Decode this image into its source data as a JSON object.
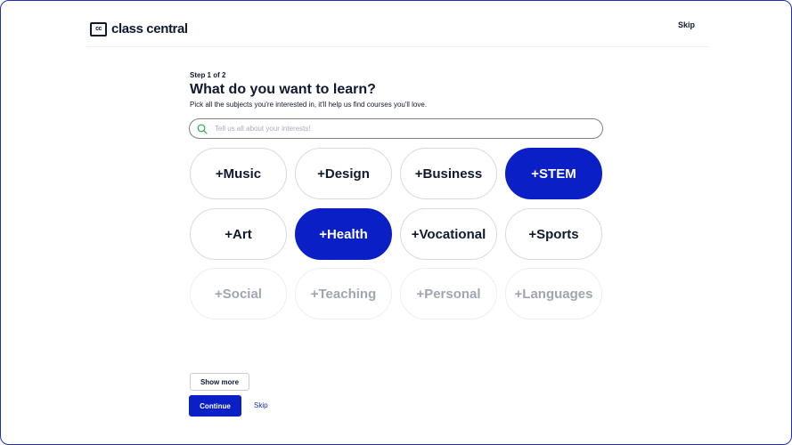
{
  "header": {
    "logo_mark": "cc",
    "logo_text": "class central",
    "skip_label": "Skip"
  },
  "step_label": "Step 1 of 2",
  "title": "What do you want to learn?",
  "subtitle": "Pick all the subjects you're interested in, it'll help us find courses you'll love.",
  "search": {
    "placeholder": "Tell us all about your interests!",
    "value": ""
  },
  "subjects": [
    {
      "label": "+Music",
      "state": "default"
    },
    {
      "label": "+Design",
      "state": "default"
    },
    {
      "label": "+Business",
      "state": "default"
    },
    {
      "label": "+STEM",
      "state": "selected"
    },
    {
      "label": "+Art",
      "state": "default"
    },
    {
      "label": "+Health",
      "state": "selected"
    },
    {
      "label": "+Vocational",
      "state": "default"
    },
    {
      "label": "+Sports",
      "state": "default"
    },
    {
      "label": "+Social",
      "state": "faded"
    },
    {
      "label": "+Teaching",
      "state": "faded"
    },
    {
      "label": "+Personal",
      "state": "faded"
    },
    {
      "label": "+Languages",
      "state": "faded"
    }
  ],
  "actions": {
    "show_more_label": "Show more",
    "continue_label": "Continue",
    "skip_label": "Skip"
  },
  "colors": {
    "accent": "#0b1fc7",
    "text": "#0f1a2e",
    "faded_text": "#a0a6b1",
    "search_icon": "#2aa84a"
  }
}
